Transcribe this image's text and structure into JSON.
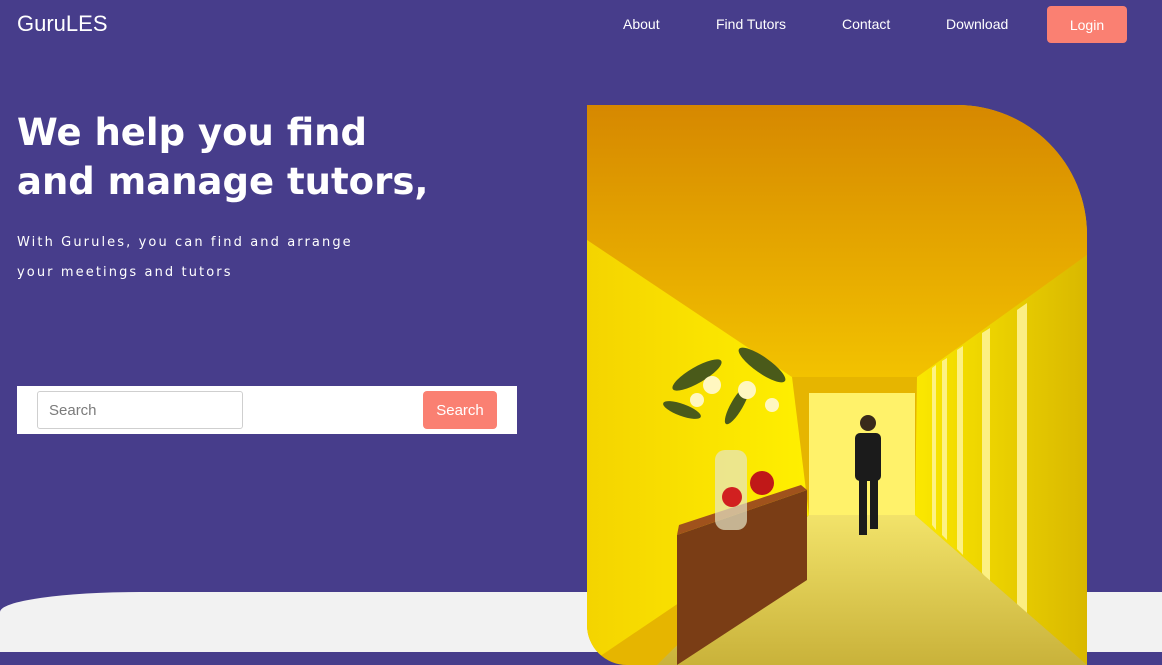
{
  "brand": {
    "name": "GuruLES"
  },
  "nav": {
    "items": [
      {
        "label": "About"
      },
      {
        "label": "Find Tutors"
      },
      {
        "label": "Contact"
      },
      {
        "label": "Download"
      }
    ],
    "login_label": "Login"
  },
  "hero": {
    "title_line1": "We help you find",
    "title_line2": "and manage tutors,",
    "subtitle_line1": "With Gurules, you can find and arrange",
    "subtitle_line2": "your meetings and tutors"
  },
  "search": {
    "placeholder": "Search",
    "button_label": "Search"
  },
  "colors": {
    "background": "#473d8b",
    "accent": "#fa8072",
    "footer": "#f2f2f2"
  }
}
